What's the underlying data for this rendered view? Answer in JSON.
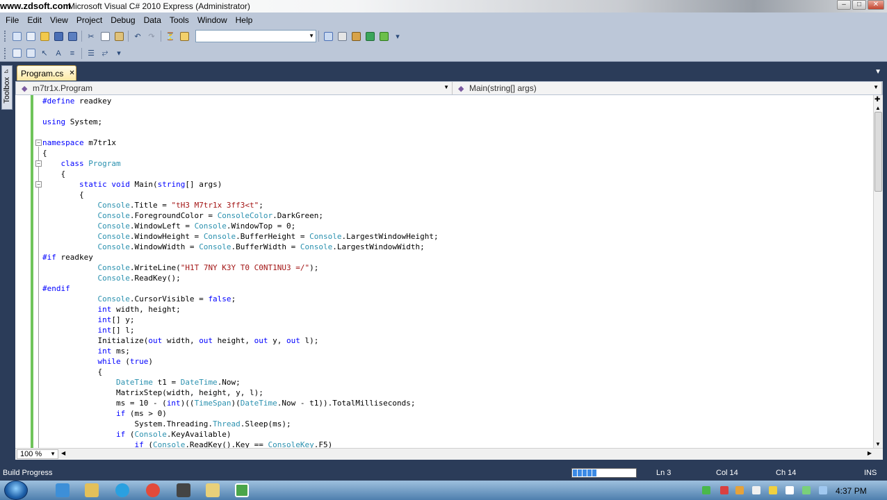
{
  "window": {
    "watermark": "www.zdsoft.com",
    "title": "Microsoft Visual C# 2010 Express (Administrator)",
    "controls": [
      "–",
      "□",
      "✕"
    ]
  },
  "menu": [
    "File",
    "Edit",
    "View",
    "Project",
    "Debug",
    "Data",
    "Tools",
    "Window",
    "Help"
  ],
  "toolbox": {
    "label": "Toolbox"
  },
  "doc_tab": {
    "name": "Program.cs",
    "close": "✕"
  },
  "nav": {
    "type": "m7tr1x.Program",
    "member": "Main(string[] args)"
  },
  "editor": {
    "lines": [
      [
        [
          "kw",
          "#define"
        ],
        [
          "",
          " readkey"
        ]
      ],
      [],
      [
        [
          "kw",
          "using"
        ],
        [
          "",
          " System;"
        ]
      ],
      [],
      [
        [
          "kw",
          "namespace"
        ],
        [
          "",
          " m7tr1x"
        ]
      ],
      [
        [
          "",
          "{"
        ]
      ],
      [
        [
          "",
          "    "
        ],
        [
          "kw",
          "class"
        ],
        [
          "",
          " "
        ],
        [
          "ty",
          "Program"
        ]
      ],
      [
        [
          "",
          "    {"
        ]
      ],
      [
        [
          "",
          "        "
        ],
        [
          "kw",
          "static"
        ],
        [
          "",
          " "
        ],
        [
          "kw",
          "void"
        ],
        [
          "",
          " Main("
        ],
        [
          "kw",
          "string"
        ],
        [
          "",
          "[] args)"
        ]
      ],
      [
        [
          "",
          "        {"
        ]
      ],
      [
        [
          "",
          "            "
        ],
        [
          "ty",
          "Console"
        ],
        [
          "",
          ".Title = "
        ],
        [
          "st",
          "\"tH3 M7tr1x 3ff3<t\""
        ],
        [
          "",
          ";"
        ]
      ],
      [
        [
          "",
          "            "
        ],
        [
          "ty",
          "Console"
        ],
        [
          "",
          ".ForegroundColor = "
        ],
        [
          "ty",
          "ConsoleColor"
        ],
        [
          "",
          ".DarkGreen;"
        ]
      ],
      [
        [
          "",
          "            "
        ],
        [
          "ty",
          "Console"
        ],
        [
          "",
          ".WindowLeft = "
        ],
        [
          "ty",
          "Console"
        ],
        [
          "",
          ".WindowTop = 0;"
        ]
      ],
      [
        [
          "",
          "            "
        ],
        [
          "ty",
          "Console"
        ],
        [
          "",
          ".WindowHeight = "
        ],
        [
          "ty",
          "Console"
        ],
        [
          "",
          ".BufferHeight = "
        ],
        [
          "ty",
          "Console"
        ],
        [
          "",
          ".LargestWindowHeight;"
        ]
      ],
      [
        [
          "",
          "            "
        ],
        [
          "ty",
          "Console"
        ],
        [
          "",
          ".WindowWidth = "
        ],
        [
          "ty",
          "Console"
        ],
        [
          "",
          ".BufferWidth = "
        ],
        [
          "ty",
          "Console"
        ],
        [
          "",
          ".LargestWindowWidth;"
        ]
      ],
      [
        [
          "kw",
          "#if"
        ],
        [
          "",
          " readkey"
        ]
      ],
      [
        [
          "",
          "            "
        ],
        [
          "ty",
          "Console"
        ],
        [
          "",
          ".WriteLine("
        ],
        [
          "st",
          "\"H1T 7NY K3Y T0 C0NT1NU3 =/\""
        ],
        [
          "",
          ");"
        ]
      ],
      [
        [
          "",
          "            "
        ],
        [
          "ty",
          "Console"
        ],
        [
          "",
          ".ReadKey();"
        ]
      ],
      [
        [
          "kw",
          "#endif"
        ]
      ],
      [
        [
          "",
          "            "
        ],
        [
          "ty",
          "Console"
        ],
        [
          "",
          ".CursorVisible = "
        ],
        [
          "kw",
          "false"
        ],
        [
          "",
          ";"
        ]
      ],
      [
        [
          "",
          "            "
        ],
        [
          "kw",
          "int"
        ],
        [
          "",
          " width, height;"
        ]
      ],
      [
        [
          "",
          "            "
        ],
        [
          "kw",
          "int"
        ],
        [
          "",
          "[] y;"
        ]
      ],
      [
        [
          "",
          "            "
        ],
        [
          "kw",
          "int"
        ],
        [
          "",
          "[] l;"
        ]
      ],
      [
        [
          "",
          "            Initialize("
        ],
        [
          "kw",
          "out"
        ],
        [
          "",
          " width, "
        ],
        [
          "kw",
          "out"
        ],
        [
          "",
          " height, "
        ],
        [
          "kw",
          "out"
        ],
        [
          "",
          " y, "
        ],
        [
          "kw",
          "out"
        ],
        [
          "",
          " l);"
        ]
      ],
      [
        [
          "",
          "            "
        ],
        [
          "kw",
          "int"
        ],
        [
          "",
          " ms;"
        ]
      ],
      [
        [
          "",
          "            "
        ],
        [
          "kw",
          "while"
        ],
        [
          "",
          " ("
        ],
        [
          "kw",
          "true"
        ],
        [
          "",
          ")"
        ]
      ],
      [
        [
          "",
          "            {"
        ]
      ],
      [
        [
          "",
          "                "
        ],
        [
          "ty",
          "DateTime"
        ],
        [
          "",
          " t1 = "
        ],
        [
          "ty",
          "DateTime"
        ],
        [
          "",
          ".Now;"
        ]
      ],
      [
        [
          "",
          "                MatrixStep(width, height, y, l);"
        ]
      ],
      [
        [
          "",
          "                ms = 10 - ("
        ],
        [
          "kw",
          "int"
        ],
        [
          "",
          ")(("
        ],
        [
          "ty",
          "TimeSpan"
        ],
        [
          "",
          ")("
        ],
        [
          "ty",
          "DateTime"
        ],
        [
          "",
          ".Now - t1)).TotalMilliseconds;"
        ]
      ],
      [
        [
          "",
          "                "
        ],
        [
          "kw",
          "if"
        ],
        [
          "",
          " (ms > 0)"
        ]
      ],
      [
        [
          "",
          "                    System.Threading."
        ],
        [
          "ty",
          "Thread"
        ],
        [
          "",
          ".Sleep(ms);"
        ]
      ],
      [
        [
          "",
          "                "
        ],
        [
          "kw",
          "if"
        ],
        [
          "",
          " ("
        ],
        [
          "ty",
          "Console"
        ],
        [
          "",
          ".KeyAvailable)"
        ]
      ],
      [
        [
          "",
          "                    "
        ],
        [
          "kw",
          "if"
        ],
        [
          "",
          " ("
        ],
        [
          "ty",
          "Console"
        ],
        [
          "",
          ".ReadKey().Key == "
        ],
        [
          "ty",
          "ConsoleKey"
        ],
        [
          "",
          ".F5)"
        ]
      ]
    ]
  },
  "zoom": "100 %",
  "status": {
    "message": "Build Progress",
    "progress": 0.42,
    "ln": "Ln 3",
    "col": "Col 14",
    "ch": "Ch 14",
    "mode": "INS"
  },
  "clock": "4:37 PM",
  "colors": {
    "chrome": "#2b3c59",
    "menu": "#bcc7d8",
    "keyword": "#0000ff",
    "type": "#2b91af",
    "string": "#a31515",
    "changebar": "#6fc45a"
  }
}
